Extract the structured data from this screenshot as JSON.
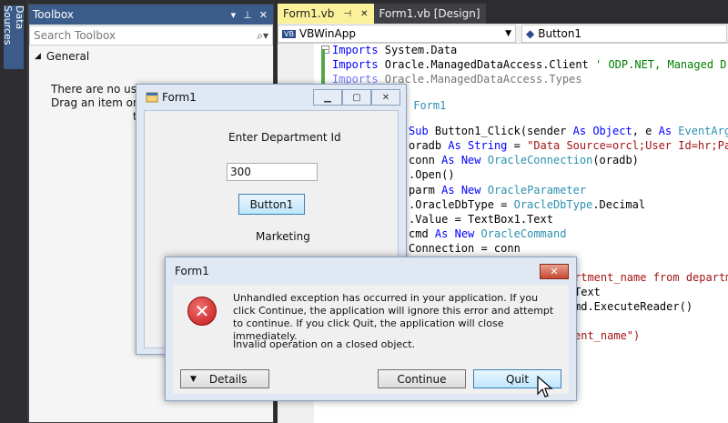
{
  "data_sources": {
    "label": "Data Sources"
  },
  "toolbox": {
    "title": "Toolbox",
    "search_placeholder": "Search Toolbox",
    "group": "General",
    "message_line1": "There are no usab",
    "message_line2": "Drag an item onto",
    "message_line3": "t"
  },
  "doc_tabs": [
    {
      "label": "Form1.vb"
    },
    {
      "label": "Form1.vb [Design]"
    }
  ],
  "navbar": {
    "project": "VBWinApp",
    "member": "Button1"
  },
  "code": {
    "line1": {
      "a": "Imports",
      "b": " System.Data"
    },
    "line2": {
      "a": "Imports",
      "b": " Oracle.ManagedDataAccess.Client ",
      "c": "' ODP.NET, Managed Dri"
    },
    "line3": {
      "a": "Imports",
      "b": " Oracle.ManagedDataAccess.Types"
    },
    "line4": {
      "b": " Form1"
    },
    "line5": {
      "a": "Sub",
      "b": " Button1_Click(sender ",
      "c": "As",
      "d": " ",
      "e": "Object",
      "f": ", e ",
      "g": "As",
      "h": " ",
      "i": "EventArgs"
    },
    "line6": {
      "a": "oradb ",
      "b": "As",
      "c": " ",
      "d": "String",
      "e": " = ",
      "f": "\"Data Source=orcl;User Id=hr;Pas"
    },
    "line7": {
      "a": "conn ",
      "b": "As",
      "c": " ",
      "d": "New",
      "e": " ",
      "f": "OracleConnection",
      "g": "(oradb)"
    },
    "line8": {
      "a": ".Open()"
    },
    "line9": {
      "a": "parm ",
      "b": "As",
      "c": " ",
      "d": "New",
      "e": " ",
      "f": "OracleParameter"
    },
    "line10": {
      "a": ".OracleDbType = ",
      "b": "OracleDbType",
      "c": ".Decimal"
    },
    "line11": {
      "a": ".Value = TextBox1.Text"
    },
    "line12": {
      "a": "cmd ",
      "b": "As",
      "c": " ",
      "d": "New",
      "e": " ",
      "f": "OracleCommand"
    },
    "line13": {
      "a": "Connection = conn"
    },
    "line14": {
      "a": "rtment_name from departm"
    },
    "line15": {
      "a": "Text"
    },
    "line16": {
      "a": "md.ExecuteReader()"
    },
    "line17": {
      "a": "ent_name\")"
    }
  },
  "form1": {
    "title": "Form1",
    "prompt_label": "Enter Department Id",
    "textbox_value": "300",
    "button_label": "Button1",
    "result_label": "Marketing"
  },
  "dialog": {
    "title": "Form1",
    "close_glyph": "✕",
    "message": "Unhandled exception has occurred in your application. If you click Continue, the application will ignore this error and attempt to continue. If you click Quit, the application will close immediately.",
    "detail": "Invalid operation on a closed object.",
    "details_label": "Details",
    "continue_label": "Continue",
    "quit_label": "Quit"
  }
}
